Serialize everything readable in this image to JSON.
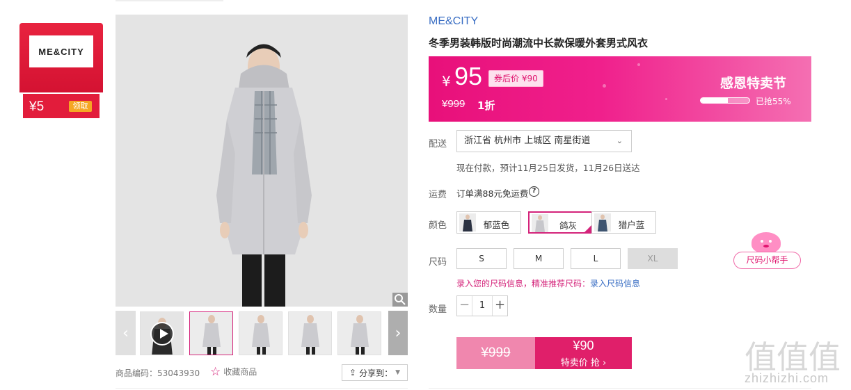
{
  "coupon": {
    "logo_text": "ME&CITY",
    "amount": "¥5",
    "get_label": "领取"
  },
  "gallery": {
    "prev_arrow": "‹",
    "next_arrow": "›"
  },
  "meta": {
    "sku": "商品编码：53043930",
    "favorite": "收藏商品",
    "share": "分享到："
  },
  "product": {
    "brand": "ME&CITY",
    "title": "冬季男装韩版时尚潮流中长款保暖外套男式风衣"
  },
  "promo": {
    "yen": "¥",
    "price": "95",
    "after_coupon": "券后价 ¥90",
    "original": "¥999",
    "discount": "1折",
    "event": "感恩特卖节",
    "sold_progress": 0.55,
    "sold_text": "已抢55%",
    "accent": "#e8107a"
  },
  "delivery": {
    "label": "配送",
    "address": "浙江省 杭州市 上城区 南星街道",
    "note": "现在付款，预计11月25日发货，11月26日送达"
  },
  "freight": {
    "label": "运费",
    "text": "订单满88元免运费",
    "help_icon": "?"
  },
  "colors": {
    "label": "颜色",
    "options": [
      {
        "name": "郁蓝色",
        "selected": false
      },
      {
        "name": "鸽灰",
        "selected": true
      },
      {
        "name": "猎户蓝",
        "selected": false
      }
    ]
  },
  "sizes": {
    "label": "尺码",
    "options": [
      {
        "name": "S",
        "available": true
      },
      {
        "name": "M",
        "available": true
      },
      {
        "name": "L",
        "available": true
      },
      {
        "name": "XL",
        "available": false
      }
    ],
    "tip": "录入您的尺码信息，精准推荐尺码：",
    "tip_link": "录入尺码信息",
    "helper": "尺码小帮手"
  },
  "quantity": {
    "label": "数量",
    "value": "1",
    "minus": "−",
    "plus": "+"
  },
  "buy": {
    "original": "¥999",
    "price": "¥90",
    "label": "特卖价 抢 ›"
  },
  "watermark": {
    "big": "值值值",
    "small": "zhizhizhi.com"
  }
}
